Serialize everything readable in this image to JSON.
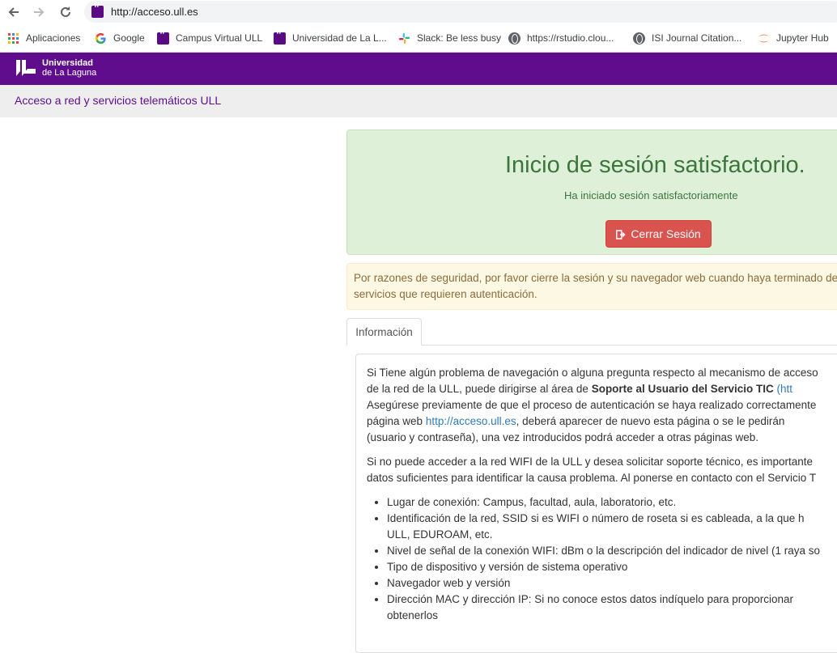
{
  "browser": {
    "url": "http://acceso.ull.es",
    "bookmarks": [
      {
        "label": "Aplicaciones",
        "icon": "apps-grid-icon"
      },
      {
        "label": "Google",
        "icon": "google-icon"
      },
      {
        "label": "Campus Virtual ULL",
        "icon": "ull-favicon-icon"
      },
      {
        "label": "Universidad de La L...",
        "icon": "ull-favicon-icon"
      },
      {
        "label": "Slack: Be less busy",
        "icon": "slack-icon"
      },
      {
        "label": "https://rstudio.clou...",
        "icon": "globe-icon"
      },
      {
        "label": "ISI Journal Citation...",
        "icon": "globe-icon"
      },
      {
        "label": "Jupyter Hub",
        "icon": "jupyter-icon"
      }
    ]
  },
  "header": {
    "logo_line1": "Universidad",
    "logo_line2": "de La Laguna",
    "subtitle": "Acceso a red y servicios telemáticos ULL"
  },
  "success": {
    "title": "Inicio de sesión satisfactorio.",
    "message": "Ha iniciado sesión satisfactoriamente",
    "logout_label": "Cerrar Sesión"
  },
  "warning": {
    "line1": "Por razones de seguridad, por favor cierre la sesión y su navegador web cuando haya terminado de utilizar los",
    "line2": "servicios que requieren autenticación."
  },
  "tabs": [
    {
      "label": "Información"
    }
  ],
  "info": {
    "p1_a": "Si Tiene algún problema de navegación o alguna pregunta respecto al mecanismo de acceso",
    "p1_b": "de la red de la ULL, puede dirigirse al área de ",
    "p1_bold": "Soporte al Usuario del Servicio TIC",
    "p1_link": " (htt",
    "p1_c": "Asegúrese previamente de que el proceso de autenticación se haya realizado correctamente",
    "p1_d": "página web ",
    "p1_url": "http://acceso.ull.es",
    "p1_e": ", deberá aparecer de nuevo esta página o se le pedirán",
    "p1_f": "(usuario y contraseña), una vez introducidos podrá acceder a otras páginas web.",
    "p2_a": "Si no puede acceder a la red WIFI de la ULL y desea solicitar soporte técnico, es importante",
    "p2_b": "datos suficientes para identificar la causa problema. Al ponerse en contacto con el Servicio T",
    "items": [
      {
        "text": "Lugar de conexión: Campus, facultad, aula, laboratorio, etc."
      },
      {
        "text": "Identificación de la red, SSID si es WIFI o número de roseta si es cableada, a la que h",
        "cont": "ULL, EDUROAM, etc."
      },
      {
        "text": "Nivel de señal de la conexión WIFI: dBm o la descripción del indicador de nivel (1 raya so"
      },
      {
        "text": "Tipo de dispositivo y versión de sistema operativo"
      },
      {
        "text": "Navegador web y versión"
      },
      {
        "text": "Dirección MAC y dirección IP: Si no conoce estos datos indíquelo para proporcionar",
        "cont": "obtenerlos"
      }
    ]
  }
}
